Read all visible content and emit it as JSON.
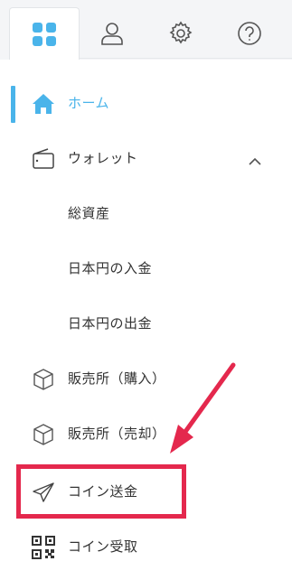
{
  "tabs": [
    {
      "name": "menu-tab",
      "icon": "grid-icon",
      "active": true
    },
    {
      "name": "account-tab",
      "icon": "user-icon",
      "active": false
    },
    {
      "name": "settings-tab",
      "icon": "gear-icon",
      "active": false
    },
    {
      "name": "help-tab",
      "icon": "question-icon",
      "active": false
    }
  ],
  "nav": {
    "home": "ホーム",
    "wallet": "ウォレット",
    "total_assets": "総資産",
    "jpy_deposit": "日本円の入金",
    "jpy_withdraw": "日本円の出金",
    "exchange_buy": "販売所（購入）",
    "exchange_sell": "販売所（売却）",
    "coin_send": "コイン送金",
    "coin_receive": "コイン受取"
  },
  "colors": {
    "accent": "#4ab4ea",
    "highlight": "#e4284d",
    "text": "#333333",
    "icon": "#444444"
  }
}
